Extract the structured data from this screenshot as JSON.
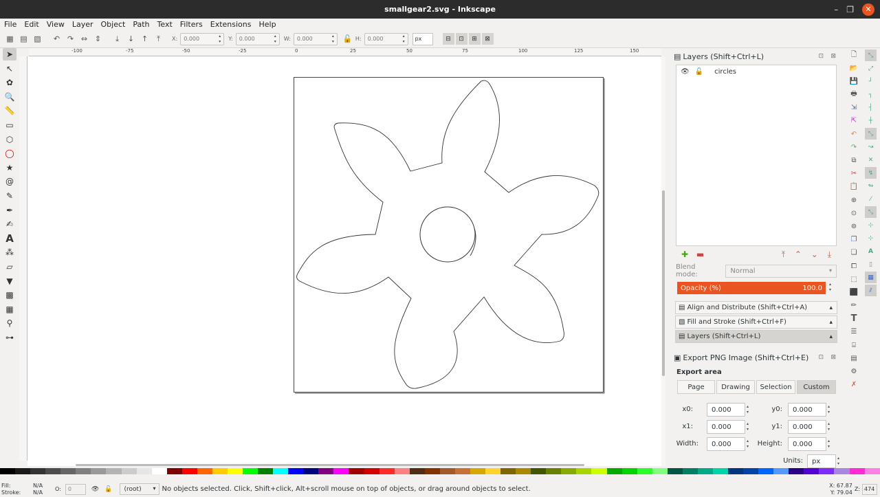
{
  "window": {
    "title": "smallgear2.svg - Inkscape"
  },
  "menu": [
    "File",
    "Edit",
    "View",
    "Layer",
    "Object",
    "Path",
    "Text",
    "Filters",
    "Extensions",
    "Help"
  ],
  "toolbar": {
    "x_label": "X:",
    "x_value": "0.000",
    "y_label": "Y:",
    "y_value": "0.000",
    "w_label": "W:",
    "w_value": "0.000",
    "h_label": "H:",
    "h_value": "0.000",
    "units": "px"
  },
  "ruler": {
    "h_ticks": [
      "-100",
      "-75",
      "-50",
      "-25",
      "0",
      "25",
      "50",
      "75",
      "100",
      "125",
      "150"
    ]
  },
  "layers_panel": {
    "title": "Layers (Shift+Ctrl+L)",
    "layers": [
      {
        "name": "circles"
      }
    ],
    "blend_label": "Blend mode:",
    "blend_value": "Normal",
    "opacity_label": "Opacity (%)",
    "opacity_value": "100.0",
    "opacity_fraction": 1.0
  },
  "collapsed_panels": [
    "Align and Distribute (Shift+Ctrl+A)",
    "Fill and Stroke (Shift+Ctrl+F)",
    "Layers (Shift+Ctrl+L)"
  ],
  "export_panel": {
    "title": "Export PNG Image (Shift+Ctrl+E)",
    "area_label": "Export area",
    "area_buttons": [
      "Page",
      "Drawing",
      "Selection",
      "Custom"
    ],
    "active_area": "Custom",
    "x0_label": "x0:",
    "x0": "0.000",
    "y0_label": "y0:",
    "y0": "0.000",
    "x1_label": "x1:",
    "x1": "0.000",
    "y1_label": "y1:",
    "y1": "0.000",
    "width_label": "Width:",
    "width": "0.000",
    "height_label": "Height:",
    "height": "0.000",
    "units_label": "Units:",
    "units": "px"
  },
  "status": {
    "fill_label": "Fill:",
    "fill_value": "N/A",
    "stroke_label": "Stroke:",
    "stroke_value": "N/A",
    "o_label": "O:",
    "o_value": "0",
    "layer": "(root)",
    "message": "No objects selected. Click, Shift+click, Alt+scroll mouse on top of objects, or drag around objects to select.",
    "cursor_x_label": "X:",
    "cursor_x": "67.87",
    "cursor_y_label": "Y:",
    "cursor_y": "79.04",
    "zoom_label": "Z:",
    "zoom": "474"
  },
  "palette": [
    "#000000",
    "#1a1a1a",
    "#333333",
    "#4d4d4d",
    "#666666",
    "#808080",
    "#999999",
    "#b3b3b3",
    "#cccccc",
    "#e6e6e6",
    "#ffffff",
    "#800000",
    "#ff0000",
    "#ff6600",
    "#ffcc00",
    "#ffff00",
    "#00ff00",
    "#008000",
    "#00ffff",
    "#0000ff",
    "#000080",
    "#800080",
    "#ff00ff",
    "#a00000",
    "#d40000",
    "#ff2a2a",
    "#ff8080",
    "#502d16",
    "#803300",
    "#a05a2c",
    "#c87137",
    "#d4aa00",
    "#ffd42a",
    "#806600",
    "#aa8800",
    "#445500",
    "#668000",
    "#88aa00",
    "#aad400",
    "#ccff00",
    "#00aa00",
    "#00d400",
    "#2aff2a",
    "#80ff80",
    "#005544",
    "#008066",
    "#00aa88",
    "#00d4aa",
    "#003380",
    "#0044aa",
    "#0066ff",
    "#5599ff",
    "#2c0089",
    "#5500d4",
    "#7f2aff",
    "#aa87de",
    "#ff2ad4",
    "#ff80e5"
  ],
  "icons": {
    "tools": [
      "selector-icon",
      "node-icon",
      "tweak-icon",
      "zoom-icon",
      "measure-icon",
      "rect-icon",
      "box3d-icon",
      "ellipse-icon",
      "star-icon",
      "spiral-icon",
      "pencil-icon",
      "pen-icon",
      "calligraphy-icon",
      "text-icon",
      "spray-icon",
      "eraser-icon",
      "bucket-icon",
      "gradient-icon",
      "mesh-icon",
      "dropper-icon",
      "connector-icon"
    ]
  }
}
